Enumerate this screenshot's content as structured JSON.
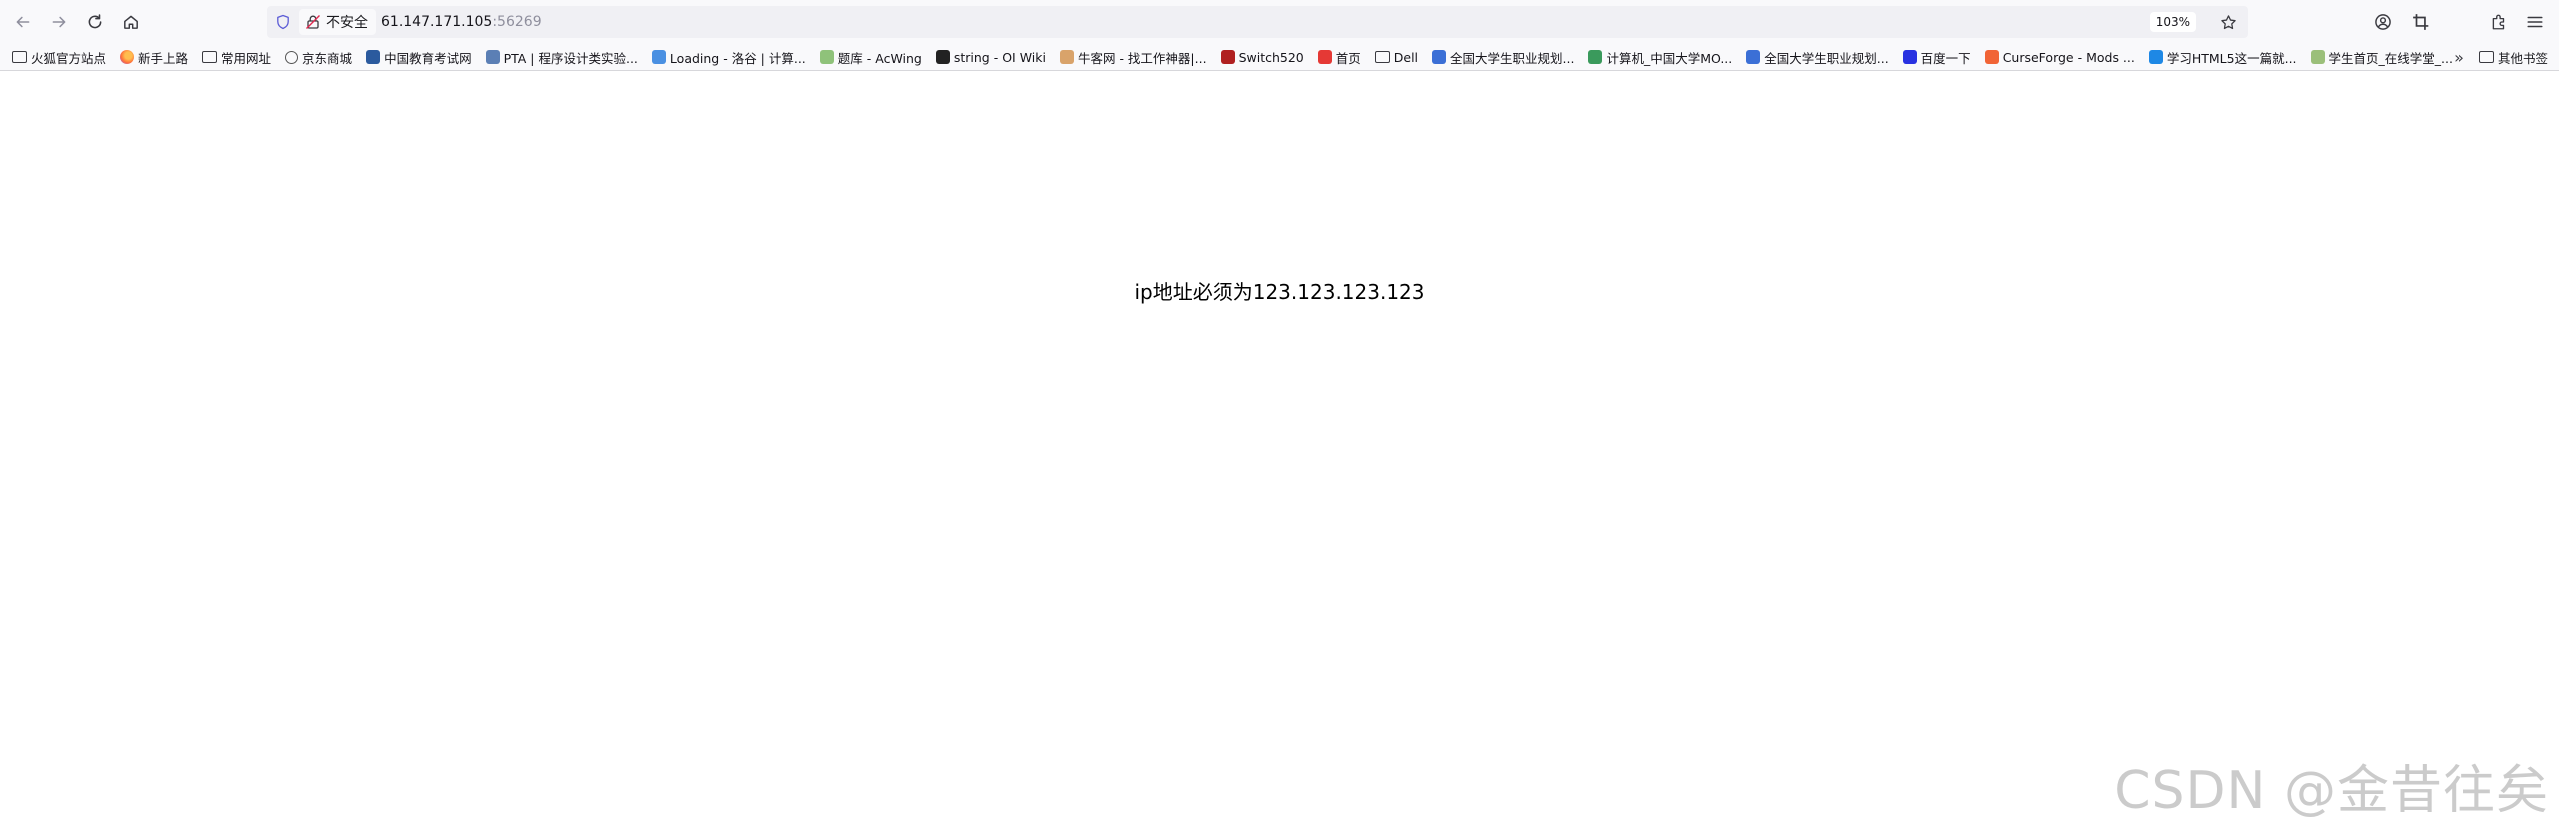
{
  "toolbar": {
    "security_label": "不安全",
    "url_host": "61.147.171.105",
    "url_port": ":56269",
    "zoom": "103%"
  },
  "icons": {
    "back": "back-arrow-icon",
    "forward": "forward-arrow-icon",
    "reload": "reload-icon",
    "home": "home-icon",
    "shield": "tracking-shield-icon",
    "insecure_lock": "insecure-lock-icon",
    "star": "bookmark-star-icon",
    "account": "account-icon",
    "screenshot": "crop-icon",
    "extensions": "extensions-icon",
    "menu": "hamburger-menu-icon"
  },
  "bookmarks": [
    {
      "label": "火狐官方站点",
      "icon": "folder",
      "color": ""
    },
    {
      "label": "新手上路",
      "icon": "firefox",
      "color": "#ff7139"
    },
    {
      "label": "常用网址",
      "icon": "folder",
      "color": ""
    },
    {
      "label": "京东商城",
      "icon": "globe",
      "color": "#555555"
    },
    {
      "label": "中国教育考试网",
      "icon": "site",
      "color": "#2b5a9e"
    },
    {
      "label": "PTA | 程序设计类实验...",
      "icon": "site",
      "color": "#5b7fb5"
    },
    {
      "label": "Loading - 洛谷 | 计算...",
      "icon": "site",
      "color": "#4a90e2"
    },
    {
      "label": "题库 - AcWing",
      "icon": "site",
      "color": "#8fc27a"
    },
    {
      "label": "string - OI Wiki",
      "icon": "site",
      "color": "#222222"
    },
    {
      "label": "牛客网 - 找工作神器|...",
      "icon": "site",
      "color": "#d9a36a"
    },
    {
      "label": "Switch520",
      "icon": "site",
      "color": "#b02020"
    },
    {
      "label": "首页",
      "icon": "site",
      "color": "#e53935"
    },
    {
      "label": "Dell",
      "icon": "folder",
      "color": ""
    },
    {
      "label": "全国大学生职业规划...",
      "icon": "site",
      "color": "#3b6fd6"
    },
    {
      "label": "计算机_中国大学MO...",
      "icon": "site",
      "color": "#3a9a5c"
    },
    {
      "label": "全国大学生职业规划...",
      "icon": "site",
      "color": "#3b6fd6"
    },
    {
      "label": "百度一下",
      "icon": "site",
      "color": "#2932e1"
    },
    {
      "label": "CurseForge - Mods ...",
      "icon": "site",
      "color": "#f16436"
    },
    {
      "label": "学习HTML5这一篇就...",
      "icon": "site",
      "color": "#1e88e5"
    },
    {
      "label": "学生首页_在线学堂_...",
      "icon": "site",
      "color": "#9bbf7a"
    }
  ],
  "bookmarks_other": "其他书签",
  "page": {
    "message": "ip地址必须为123.123.123.123"
  },
  "watermark": "CSDN @金昔往矣"
}
